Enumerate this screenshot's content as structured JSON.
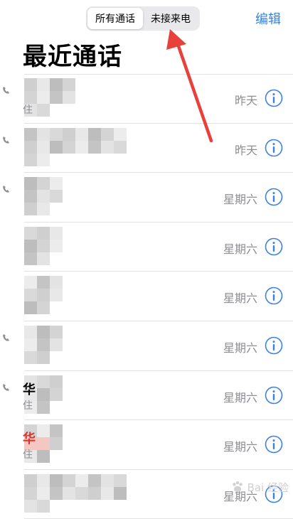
{
  "header": {
    "segments": [
      {
        "label": "所有通话",
        "active": true
      },
      {
        "label": "未接来电",
        "active": false
      }
    ],
    "edit_label": "编辑",
    "title": "最近通话"
  },
  "calls": [
    {
      "time": "昨天",
      "name_fragment": "",
      "subtitle_fragment": "住"
    },
    {
      "time": "昨天",
      "name_fragment": "",
      "subtitle_fragment": ""
    },
    {
      "time": "星期六",
      "name_fragment": "",
      "subtitle_fragment": ""
    },
    {
      "time": "星期六",
      "name_fragment": "",
      "subtitle_fragment": ""
    },
    {
      "time": "星期六",
      "name_fragment": "",
      "subtitle_fragment": ""
    },
    {
      "time": "星期六",
      "name_fragment": "",
      "subtitle_fragment": ""
    },
    {
      "time": "星期六",
      "name_fragment": "华",
      "subtitle_fragment": "住"
    },
    {
      "time": "星期六",
      "name_fragment": "华",
      "subtitle_fragment": "住"
    },
    {
      "time": "星期六",
      "name_fragment": "",
      "subtitle_fragment": ""
    }
  ],
  "watermark": "Bai 经验",
  "colors": {
    "accent": "#3b82e0",
    "secondary_text": "#8e8e93",
    "annotation_arrow": "#e8403a",
    "missed_call": "#d8342c"
  },
  "icons": {
    "info": "info-circle-icon",
    "outgoing_call": "outgoing-call-icon",
    "annotation": "red-arrow"
  }
}
